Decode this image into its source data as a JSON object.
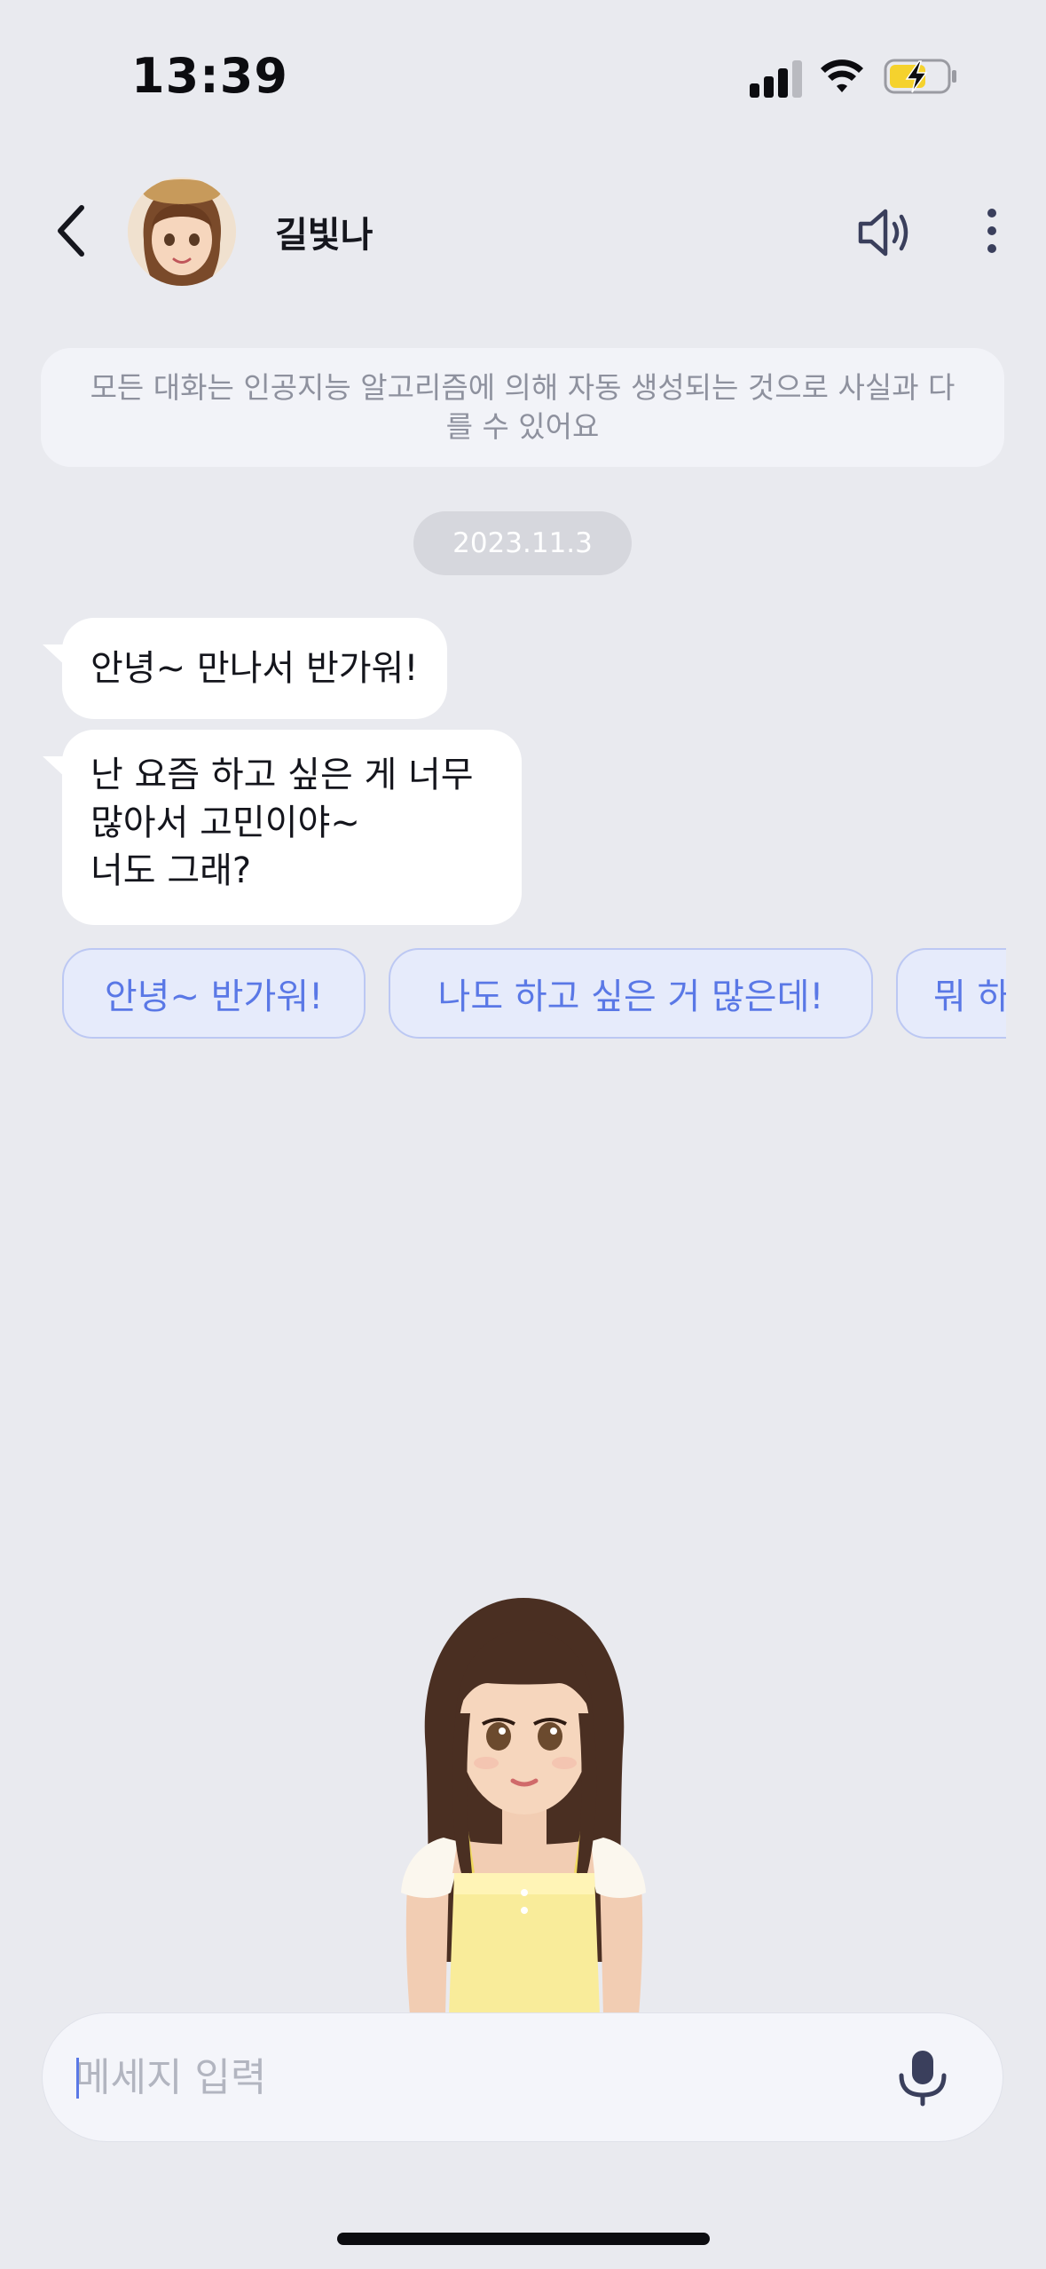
{
  "status_bar": {
    "time": "13:39"
  },
  "header": {
    "name": "길빛나"
  },
  "disclaimer": "모든 대화는 인공지능 알고리즘에 의해 자동 생성되는 것으로 사실과 다를 수 있어요",
  "date": "2023.11.3",
  "messages": [
    {
      "text": "안녕~ 만나서 반가워!"
    },
    {
      "text": "난 요즘 하고 싶은 게 너무\n많아서 고민이야~\n너도 그래?"
    }
  ],
  "suggestions": [
    {
      "label": "안녕~ 반가워!"
    },
    {
      "label": "나도 하고 싶은 거 많은데!"
    },
    {
      "label": "뭐 하"
    }
  ],
  "input": {
    "placeholder": "메세지 입력",
    "value": ""
  },
  "colors": {
    "background": "#e9eaef",
    "bubble": "#ffffff",
    "chip_bg": "#e6ebfb",
    "chip_text": "#5a78e6",
    "icon": "#3a3f5c"
  }
}
